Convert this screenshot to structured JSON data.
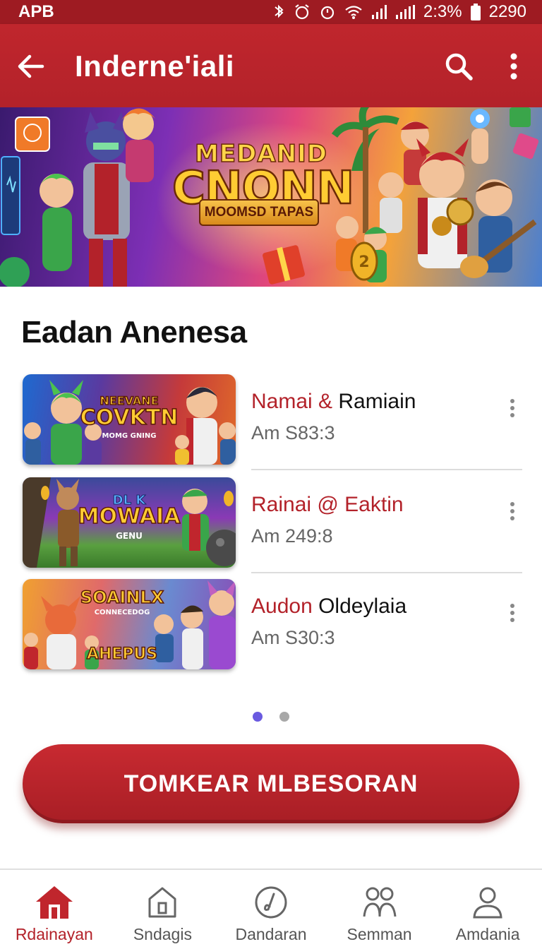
{
  "status_bar": {
    "carrier": "APB",
    "battery_percent": "2:3%",
    "time": "2290"
  },
  "app_bar": {
    "title": "Inderne'iali"
  },
  "hero_banner": {
    "title_top": "MEDANID",
    "title_main": "CNONN",
    "subtitle": "MOOMSD TAPAS"
  },
  "section": {
    "title": "Eadan Anenesa"
  },
  "items": [
    {
      "title_accent": "Namai &",
      "title_rest": " Ramiain",
      "subtitle": "Am S83:3",
      "thumb_line1": "NEEVANE",
      "thumb_line2": "COVKTN",
      "thumb_line3": "MOMG GNING"
    },
    {
      "title_accent": "Rainai @ Eaktin",
      "title_rest": "",
      "subtitle": "Am 249:8",
      "thumb_line1": "DL K",
      "thumb_line2": "MOWAIA",
      "thumb_line3": "GENU"
    },
    {
      "title_accent": "Audon",
      "title_rest": " Oldeylaia",
      "subtitle": "Am S30:3",
      "thumb_line1": "SOAINLX",
      "thumb_line2": "CONNECEDOG",
      "thumb_line3": "AHEPUS"
    }
  ],
  "pager": {
    "count": 2,
    "active": 0
  },
  "cta": {
    "label": "TOMKEAR MLBESORAN"
  },
  "bottom_nav": [
    {
      "label": "Rdainayan",
      "icon": "home-icon",
      "active": true
    },
    {
      "label": "Sndagis",
      "icon": "house-outline-icon",
      "active": false
    },
    {
      "label": "Dandaran",
      "icon": "music-disc-icon",
      "active": false
    },
    {
      "label": "Semman",
      "icon": "group-icon",
      "active": false
    },
    {
      "label": "Amdania",
      "icon": "profile-icon",
      "active": false
    }
  ],
  "colors": {
    "primary": "#b3222a",
    "status_bar": "#9e1b22",
    "pager_active": "#6a5ae0"
  }
}
